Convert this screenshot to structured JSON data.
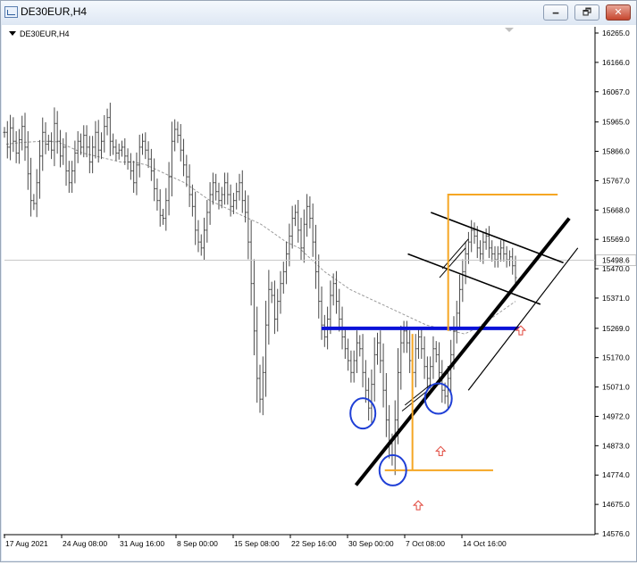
{
  "window": {
    "title": "DE30EUR,H4",
    "minimize_label": "🗕",
    "maximize_label": "🗗",
    "close_label": "✕"
  },
  "chart_header": {
    "label": "DE30EUR,H4"
  },
  "chart_data": {
    "type": "line",
    "symbol": "DE30EUR",
    "timeframe": "H4",
    "ylim": [
      14576,
      16265
    ],
    "y_ticks": [
      16265.0,
      16166.0,
      16067.0,
      15965.0,
      15866.0,
      15767.0,
      15668.0,
      15569.0,
      15470.0,
      15371.0,
      15269.0,
      15170.0,
      15071.0,
      14972.0,
      14873.0,
      14774.0,
      14675.0,
      14576.0
    ],
    "x_tick_labels": [
      "17 Aug 2021",
      "24 Aug 08:00",
      "31 Aug 16:00",
      "8 Sep 00:00",
      "15 Sep 08:00",
      "22 Sep 16:00",
      "30 Sep 00:00",
      "7 Oct 08:00",
      "14 Oct 16:00"
    ],
    "current_price": 15498.6,
    "price_series": [
      15930,
      15880,
      15945,
      15900,
      15860,
      15905,
      15950,
      15880,
      15790,
      15700,
      15690,
      15760,
      15850,
      15930,
      15890,
      15900,
      15870,
      15960,
      15900,
      15850,
      15880,
      15800,
      15760,
      15800,
      15860,
      15900,
      15880,
      15920,
      15880,
      15830,
      15880,
      15930,
      15870,
      15900,
      15950,
      15980,
      15900,
      15880,
      15860,
      15870,
      15880,
      15850,
      15830,
      15800,
      15760,
      15820,
      15880,
      15900,
      15870,
      15840,
      15800,
      15740,
      15700,
      15650,
      15640,
      15700,
      15780,
      15900,
      15940,
      15920,
      15870,
      15820,
      15780,
      15720,
      15680,
      15600,
      15560,
      15540,
      15600,
      15660,
      15720,
      15760,
      15730,
      15700,
      15720,
      15760,
      15720,
      15680,
      15700,
      15730,
      15760,
      15700,
      15660,
      15560,
      15420,
      15260,
      15100,
      15030,
      15120,
      15280,
      15400,
      15380,
      15300,
      15360,
      15420,
      15460,
      15520,
      15580,
      15640,
      15660,
      15600,
      15540,
      15620,
      15680,
      15640,
      15560,
      15460,
      15360,
      15280,
      15240,
      15300,
      15380,
      15420,
      15360,
      15300,
      15240,
      15200,
      15160,
      15120,
      15160,
      15220,
      15200,
      15120,
      15060,
      15000,
      15080,
      15180,
      15220,
      15160,
      15060,
      14960,
      14880,
      14840,
      14960,
      15120,
      15220,
      15260,
      15220,
      15160,
      15120,
      15200,
      15240,
      15200,
      15140,
      15100,
      15140,
      15200,
      15180,
      15120,
      15060,
      15040,
      15100,
      15180,
      15260,
      15320,
      15400,
      15460,
      15520,
      15560,
      15600,
      15580,
      15540,
      15520,
      15560,
      15580,
      15540,
      15520,
      15500,
      15520,
      15540,
      15520,
      15500,
      15510,
      15480,
      15440
    ],
    "ma_series": [
      15890,
      15895,
      15898,
      15900,
      15898,
      15880,
      15860,
      15850,
      15840,
      15830,
      15830,
      15820,
      15800,
      15780,
      15760,
      15730,
      15700,
      15680,
      15660,
      15640,
      15620,
      15590,
      15560,
      15540,
      15500,
      15460,
      15430,
      15400,
      15380,
      15360,
      15340,
      15320,
      15300,
      15280,
      15270,
      15260,
      15250,
      15270,
      15300,
      15330,
      15360
    ],
    "drawn_objects": {
      "support_line": {
        "y": 15269
      },
      "uptrend_line": {
        "x1": 0.61,
        "y1": 14740,
        "x2": 0.98,
        "y2": 15640
      },
      "descending_channel": {
        "upper": {
          "x1": 0.74,
          "y1": 15660,
          "x2": 0.97,
          "y2": 15490
        },
        "lower": {
          "x1": 0.7,
          "y1": 15520,
          "x2": 0.93,
          "y2": 15350
        }
      },
      "orange_brackets": {
        "lower_level": 14790,
        "upper_level": 15720
      },
      "blue_circles": 3,
      "red_up_arrows": 3
    }
  }
}
